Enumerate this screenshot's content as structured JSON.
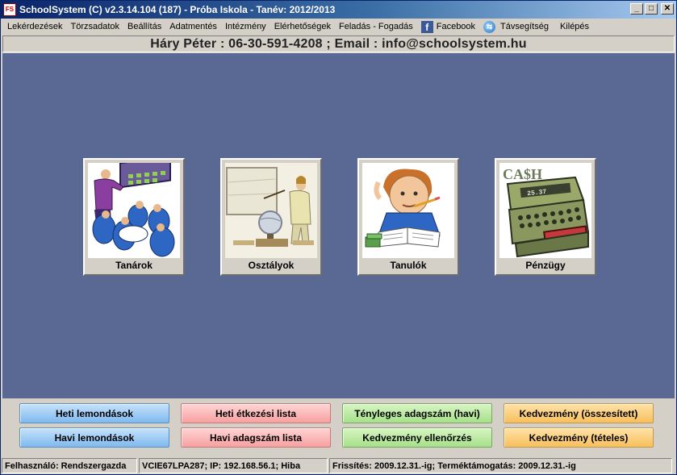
{
  "window": {
    "title": "SchoolSystem (C) v2.3.14.104 (187) - Próba Iskola - Tanév: 2012/2013",
    "app_icon": "app-logo-icon"
  },
  "menu": {
    "items": [
      "Lekérdezések",
      "Törzsadatok",
      "Beállítás",
      "Adatmentés",
      "Intézmény",
      "Elérhetőségek",
      "Feladás - Fogadás"
    ],
    "facebook": "Facebook",
    "remote_help": "Távsegítség",
    "exit": "Kilépés"
  },
  "contact": "Háry Péter : 06-30-591-4208  ;  Email : info@schoolsystem.hu",
  "tiles": [
    {
      "label": "Tanárok",
      "icon": "teachers-icon"
    },
    {
      "label": "Osztályok",
      "icon": "classroom-icon"
    },
    {
      "label": "Tanulók",
      "icon": "student-icon"
    },
    {
      "label": "Pénzügy",
      "icon": "cash-register-icon"
    }
  ],
  "cash_text": "CA$H",
  "buttons": {
    "heti_lemondasok": "Heti lemondások",
    "havi_lemondasok": "Havi lemondások",
    "heti_etkezesi_lista": "Heti étkezési lista",
    "havi_adagszam_lista": "Havi adagszám lista",
    "tenyleges_adagszam": "Tényleges adagszám (havi)",
    "kedvezmeny_ellenorzes": "Kedvezmény ellenőrzés",
    "kedvezmeny_osszesitett": "Kedvezmény (összesített)",
    "kedvezmeny_teteles": "Kedvezmény (tételes)"
  },
  "colors": {
    "main_background": "#5a6894",
    "title_bar": "#0a246a",
    "blue_button": "#9ccbf5",
    "red_button": "#f9b8b8",
    "green_button": "#b9eba0",
    "orange_button": "#fbcd78"
  },
  "status": {
    "user": "Felhasználó: Rendszergazda",
    "machine": "VCIE67LPA287; IP: 192.168.56.1; Hiba",
    "license": "Frissítés: 2009.12.31.-ig; Terméktámogatás: 2009.12.31.-ig"
  }
}
